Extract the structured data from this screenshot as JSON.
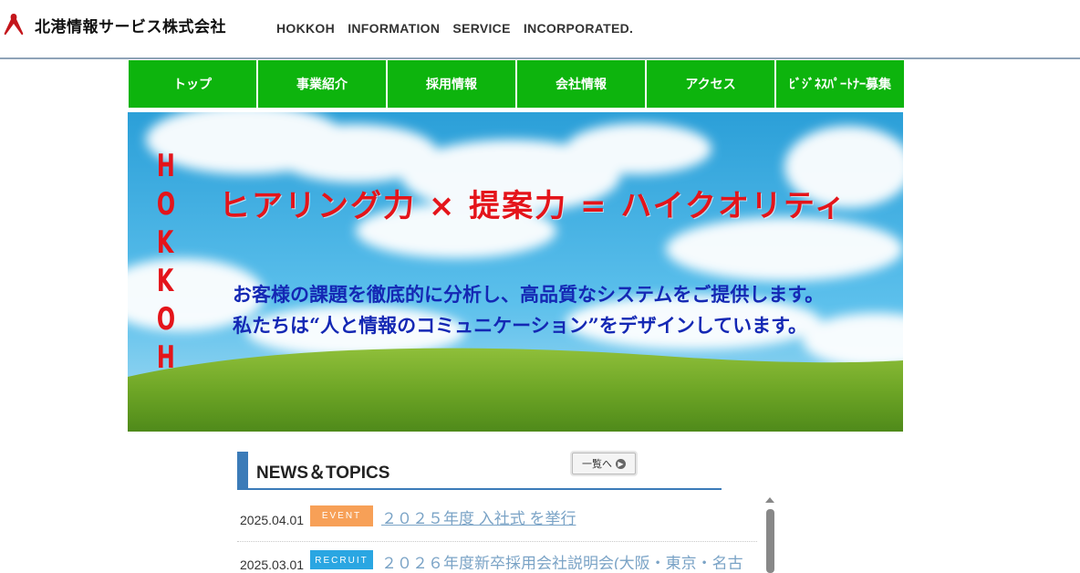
{
  "header": {
    "company_name": "北港情報サービス株式会社",
    "english_name": "HOKKOH INFORMATION SERVICE INCORPORATED."
  },
  "nav": {
    "items": [
      {
        "label": "トップ"
      },
      {
        "label": "事業紹介"
      },
      {
        "label": "採用情報"
      },
      {
        "label": "会社情報"
      },
      {
        "label": "アクセス"
      },
      {
        "label": "ﾋﾞｼﾞﾈｽﾊﾟｰﾄﾅｰ募集"
      }
    ]
  },
  "hero": {
    "vertical_text": "HOKKOH",
    "tagline": "ヒアリング力 × 提案力 = ハイクオリティ",
    "line1": "お客様の課題を徹底的に分析し、高品質なシステムをご提供します。",
    "line2": "私たちは“人と情報のコミュニケーション”をデザインしています。"
  },
  "news": {
    "title": "NEWS＆TOPICS",
    "more_label": "一覧へ",
    "items": [
      {
        "date": "2025.04.01",
        "category": "EVENT",
        "title": "２０２５年度 入社式 を挙行"
      },
      {
        "date": "2025.03.01",
        "category": "RECRUIT",
        "title": "２０２６年度新卒採用会社説明会(大阪・東京・名古"
      }
    ]
  },
  "colors": {
    "nav_green": "#0db40d",
    "tagline_red": "#e4141a",
    "message_blue": "#1428b4",
    "news_accent": "#3b7bb8",
    "event_badge": "#f7a057",
    "recruit_badge": "#2aa6e2"
  }
}
